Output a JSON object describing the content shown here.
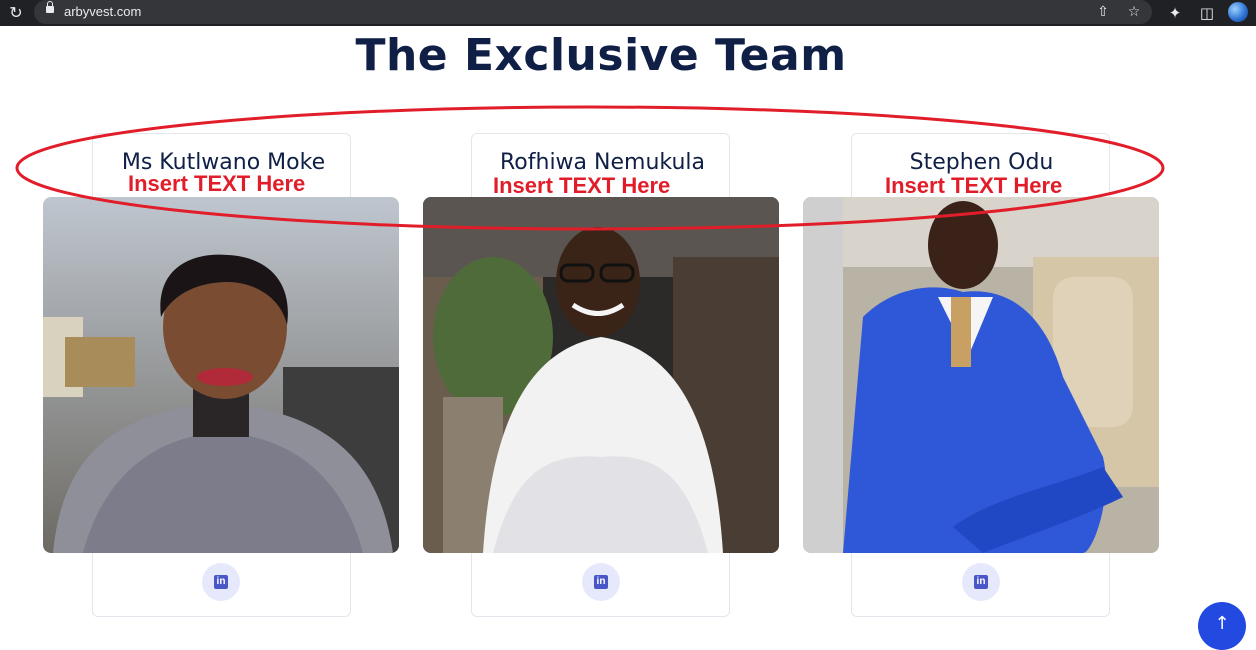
{
  "browser": {
    "url": "arbyvest.com"
  },
  "page": {
    "title": "The Exclusive Team"
  },
  "team": [
    {
      "name": "Ms Kutlwano Moke",
      "caption": "Insert TEXT Here",
      "social": "in"
    },
    {
      "name": "Rofhiwa Nemukula",
      "caption": "Insert TEXT Here",
      "social": "in"
    },
    {
      "name": "Stephen Odu",
      "caption": "Insert TEXT Here",
      "social": "in"
    }
  ],
  "colors": {
    "heading": "#0f1f45",
    "annotation": "#e21d2a",
    "accent": "#2249e0"
  },
  "icons": [
    "reload-icon",
    "lock-icon",
    "share-icon",
    "star-icon",
    "extensions-icon",
    "side-panel-icon",
    "profile-icon",
    "linkedin-icon",
    "arrow-up-icon"
  ]
}
